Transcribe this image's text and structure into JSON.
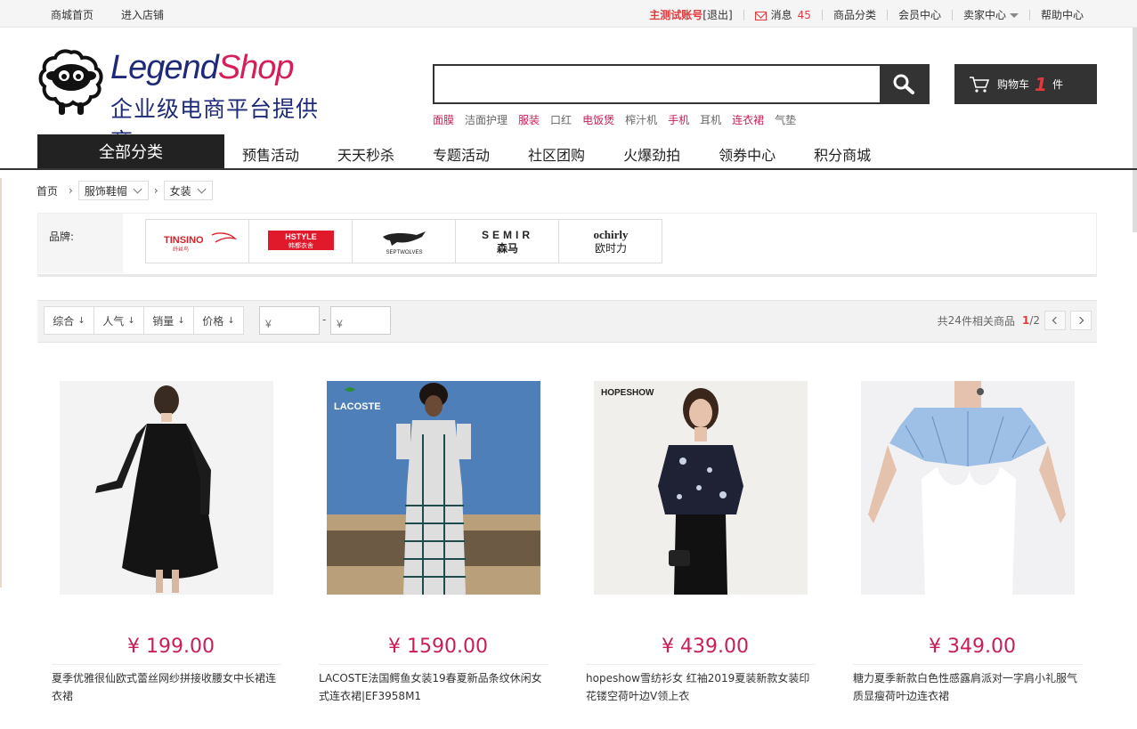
{
  "topbar": {
    "mall_home": "商城首页",
    "enter_store": "进入店铺",
    "account_name": "主测试账号",
    "logout": "[退出]",
    "messages_label": "消息",
    "messages_count": "45",
    "categories": "商品分类",
    "member_center": "会员中心",
    "seller_center": "卖家中心",
    "help_center": "帮助中心"
  },
  "logo": {
    "text_a": "Legend",
    "text_b": "Shop",
    "slogan": "企业级电商平台提供商"
  },
  "search": {
    "value": "",
    "hot_words": [
      {
        "text": "面膜",
        "hot": true
      },
      {
        "text": "洁面护理",
        "hot": false
      },
      {
        "text": "服装",
        "hot": true
      },
      {
        "text": "口红",
        "hot": false
      },
      {
        "text": "电饭煲",
        "hot": true
      },
      {
        "text": "榨汁机",
        "hot": false
      },
      {
        "text": "手机",
        "hot": true
      },
      {
        "text": "耳机",
        "hot": false
      },
      {
        "text": "连衣裙",
        "hot": true
      },
      {
        "text": "气垫",
        "hot": false
      }
    ]
  },
  "cart": {
    "label": "购物车",
    "count": "1",
    "unit": "件"
  },
  "nav": {
    "all_categories": "全部分类",
    "items": [
      "预售活动",
      "天天秒杀",
      "专题活动",
      "社区团购",
      "火爆劲拍",
      "领券中心",
      "积分商城"
    ]
  },
  "breadcrumb": {
    "home": "首页",
    "level1": "服饰鞋帽",
    "level2": "女装"
  },
  "brands": {
    "label": "品牌:",
    "items": [
      {
        "name": "TINSINO",
        "sub": "纤丝鸟",
        "color": "#d8202a"
      },
      {
        "name": "HSTYLE",
        "sub": "韩都衣舍",
        "color": "#e0192b"
      },
      {
        "name": "SEPTWOLVES",
        "sub": "",
        "color": "#222222"
      },
      {
        "name": "SEMIR",
        "sub": "森马",
        "color": "#222222"
      },
      {
        "name": "ochirly",
        "sub": "欧时力",
        "color": "#222222"
      }
    ]
  },
  "filter": {
    "sorts": [
      "综合",
      "人气",
      "销量",
      "价格"
    ],
    "price_min_placeholder": "¥",
    "price_max_placeholder": "¥",
    "dash": "-",
    "total_prefix": "共",
    "total_count": "24",
    "total_suffix": "件相关商品",
    "page_current": "1",
    "page_total": "/2"
  },
  "products": [
    {
      "price": "¥ 199.00",
      "title": "夏季优雅很仙欧式蕾丝网纱拼接收腰女中长裙连衣裙",
      "image": "black-lace-dress"
    },
    {
      "price": "¥ 1590.00",
      "title": "LACOSTE法国鳄鱼女装19春夏新品条纹休闲女式连衣裙|EF3958M1",
      "image": "striped-polo-dress",
      "brand_mark": "LACOSTE"
    },
    {
      "price": "¥ 439.00",
      "title": "hopeshow雪纺衫女 红袖2019夏装新款女装印花镂空荷叶边V领上衣",
      "image": "floral-blouse",
      "brand_mark": "HOPESHOW"
    },
    {
      "price": "¥ 349.00",
      "title": "糖力夏季新款白色性感露肩派对一字肩小礼服气质显瘦荷叶边连衣裙",
      "image": "off-shoulder-dress"
    }
  ]
}
